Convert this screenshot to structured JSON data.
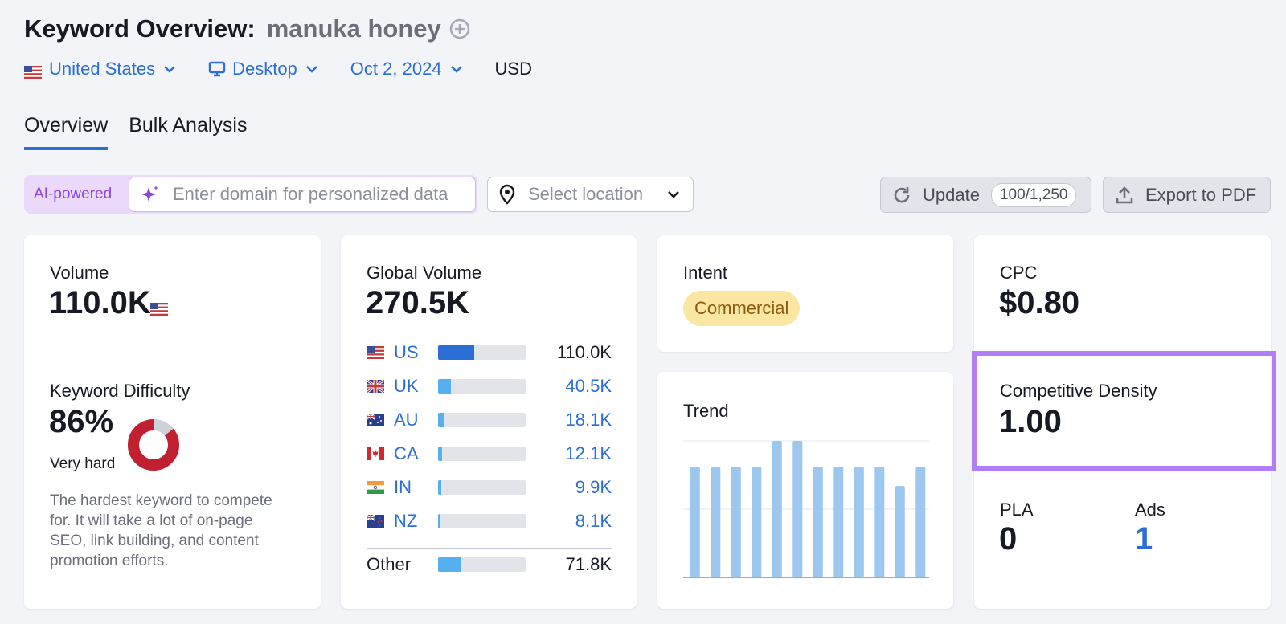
{
  "header": {
    "title": "Keyword Overview:",
    "keyword": "manuka honey"
  },
  "filters": {
    "country": "United States",
    "device": "Desktop",
    "date": "Oct 2, 2024",
    "currency": "USD"
  },
  "tabs": [
    {
      "label": "Overview",
      "active": true
    },
    {
      "label": "Bulk Analysis",
      "active": false
    }
  ],
  "toolbar": {
    "ai_label": "AI-powered",
    "ai_placeholder": "Enter domain for personalized data",
    "location_placeholder": "Select location",
    "update_label": "Update",
    "update_counter": "100/1,250",
    "export_label": "Export to PDF"
  },
  "volume_card": {
    "label": "Volume",
    "value": "110.0K",
    "kd_label": "Keyword Difficulty",
    "kd_value": "86%",
    "kd_level": "Very hard",
    "kd_percent": 86,
    "kd_description": "The hardest keyword to compete for. It will take a lot of on-page SEO, link building, and content promotion efforts."
  },
  "global_card": {
    "label": "Global Volume",
    "value": "270.5K",
    "rows": [
      {
        "code": "US",
        "value": "110.0K",
        "share": 0.41,
        "flag": "us-flag"
      },
      {
        "code": "UK",
        "value": "40.5K",
        "share": 0.15,
        "flag": "uk-flag"
      },
      {
        "code": "AU",
        "value": "18.1K",
        "share": 0.07,
        "flag": "au-flag"
      },
      {
        "code": "CA",
        "value": "12.1K",
        "share": 0.045,
        "flag": "ca-flag"
      },
      {
        "code": "IN",
        "value": "9.9K",
        "share": 0.037,
        "flag": "in-flag"
      },
      {
        "code": "NZ",
        "value": "8.1K",
        "share": 0.03,
        "flag": "nz-flag"
      }
    ],
    "other": {
      "label": "Other",
      "value": "71.8K",
      "share": 0.265
    }
  },
  "intent_card": {
    "label": "Intent",
    "badge": "Commercial"
  },
  "trend_card": {
    "label": "Trend"
  },
  "cpc_card": {
    "cpc_label": "CPC",
    "cpc_value": "$0.80",
    "cd_label": "Competitive Density",
    "cd_value": "1.00",
    "pla_label": "PLA",
    "pla_value": "0",
    "ads_label": "Ads",
    "ads_value": "1"
  },
  "colors": {
    "accent": "#2b6fd6",
    "highlight": "#b27ef5",
    "difficulty": "#c0202f",
    "bar_us": "#2b6fd6",
    "bar_other": "#56b0f0",
    "trend_bar": "#9cc7ee"
  },
  "chart_data": {
    "type": "bar",
    "values": [
      0.81,
      0.81,
      0.81,
      0.81,
      1.0,
      1.0,
      0.81,
      0.81,
      0.81,
      0.81,
      0.67,
      0.81
    ],
    "ylim": [
      0,
      1
    ],
    "grid": true
  }
}
